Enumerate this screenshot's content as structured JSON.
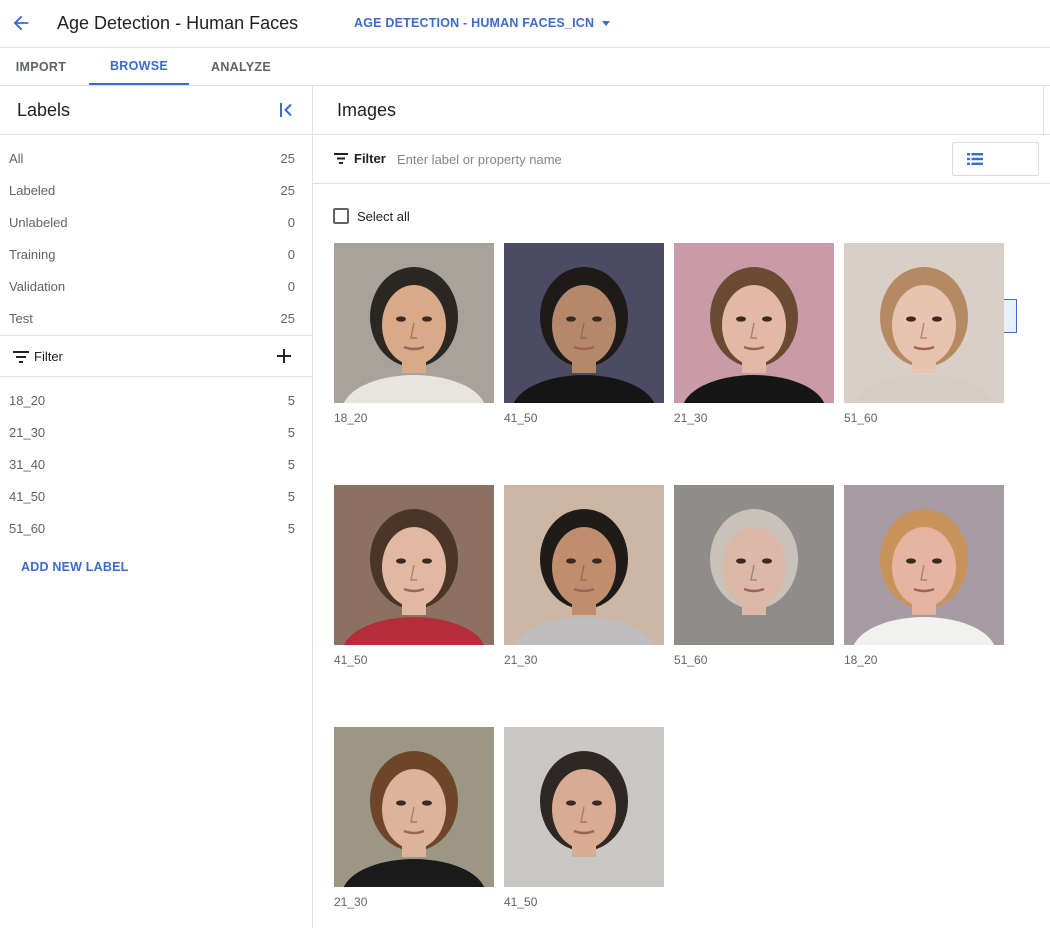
{
  "header": {
    "title": "Age Detection - Human Faces",
    "dataset": "AGE DETECTION - HUMAN FACES_ICN"
  },
  "tabs": [
    {
      "label": "IMPORT"
    },
    {
      "label": "BROWSE"
    },
    {
      "label": "ANALYZE"
    }
  ],
  "sidebar": {
    "title": "Labels",
    "summary": [
      {
        "label": "All",
        "count": "25"
      },
      {
        "label": "Labeled",
        "count": "25"
      },
      {
        "label": "Unlabeled",
        "count": "0"
      },
      {
        "label": "Training",
        "count": "0"
      },
      {
        "label": "Validation",
        "count": "0"
      },
      {
        "label": "Test",
        "count": "25"
      }
    ],
    "filter_label": "Filter",
    "labels": [
      {
        "label": "18_20",
        "count": "5"
      },
      {
        "label": "21_30",
        "count": "5"
      },
      {
        "label": "31_40",
        "count": "5"
      },
      {
        "label": "41_50",
        "count": "5"
      },
      {
        "label": "51_60",
        "count": "5"
      }
    ],
    "add_label": "ADD NEW LABEL"
  },
  "main": {
    "title": "Images",
    "filter_label": "Filter",
    "filter_placeholder": "Enter label or property name",
    "select_all": "Select all",
    "images": [
      {
        "label": "18_20",
        "bg": "#a8a29a",
        "skin": "#d9a988",
        "hair": "#2a2622",
        "shirt": "#e8e4df"
      },
      {
        "label": "41_50",
        "bg": "#4d4a63",
        "skin": "#b5886b",
        "hair": "#1e1a18",
        "shirt": "#151515"
      },
      {
        "label": "21_30",
        "bg": "#c99aa8",
        "skin": "#e2b9a6",
        "hair": "#6b4a32",
        "shirt": "#161616"
      },
      {
        "label": "51_60",
        "bg": "#d9cfc6",
        "skin": "#e8c4b0",
        "hair": "#b58a62",
        "shirt": "#d5ccc3"
      },
      {
        "label": "41_50",
        "bg": "#8c7163",
        "skin": "#e1b9a2",
        "hair": "#4a3527",
        "shirt": "#b32e3a"
      },
      {
        "label": "21_30",
        "bg": "#cdb6a4",
        "skin": "#c08e6d",
        "hair": "#1f1b19",
        "shirt": "#bfbdbd"
      },
      {
        "label": "51_60",
        "bg": "#8e8d8a",
        "skin": "#dcb8a8",
        "hair": "#c9c2ba",
        "shirt": "#8e8d8a"
      },
      {
        "label": "18_20",
        "bg": "#a89aa3",
        "skin": "#e6b4a0",
        "hair": "#c7935b",
        "shirt": "#f1f1ef"
      },
      {
        "label": "21_30",
        "bg": "#9d9684",
        "skin": "#dcb39b",
        "hair": "#6d4528",
        "shirt": "#1a1a1a"
      },
      {
        "label": "41_50",
        "bg": "#c9c7c4",
        "skin": "#d9ab93",
        "hair": "#2e2824",
        "shirt": "#c9c7c4"
      }
    ]
  },
  "colors": {
    "accent": "#3c6bc9",
    "divider": "#e0e0e0"
  }
}
